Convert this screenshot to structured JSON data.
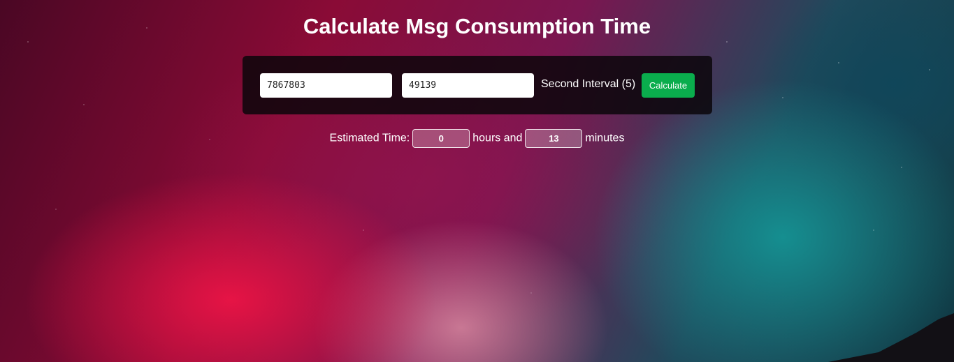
{
  "page": {
    "title": "Calculate Msg Consumption Time"
  },
  "form": {
    "input_1_value": "7867803",
    "input_2_value": "49139",
    "interval_label": "Second Interval (5)",
    "calculate_label": "Calculate"
  },
  "result": {
    "estimated_label": "Estimated Time:",
    "hours_value": "0",
    "hours_label": "hours and",
    "minutes_value": "13",
    "minutes_label": "minutes"
  },
  "colors": {
    "button": "#0aad4d",
    "panel": "#0a060a",
    "text": "#ffffff"
  }
}
